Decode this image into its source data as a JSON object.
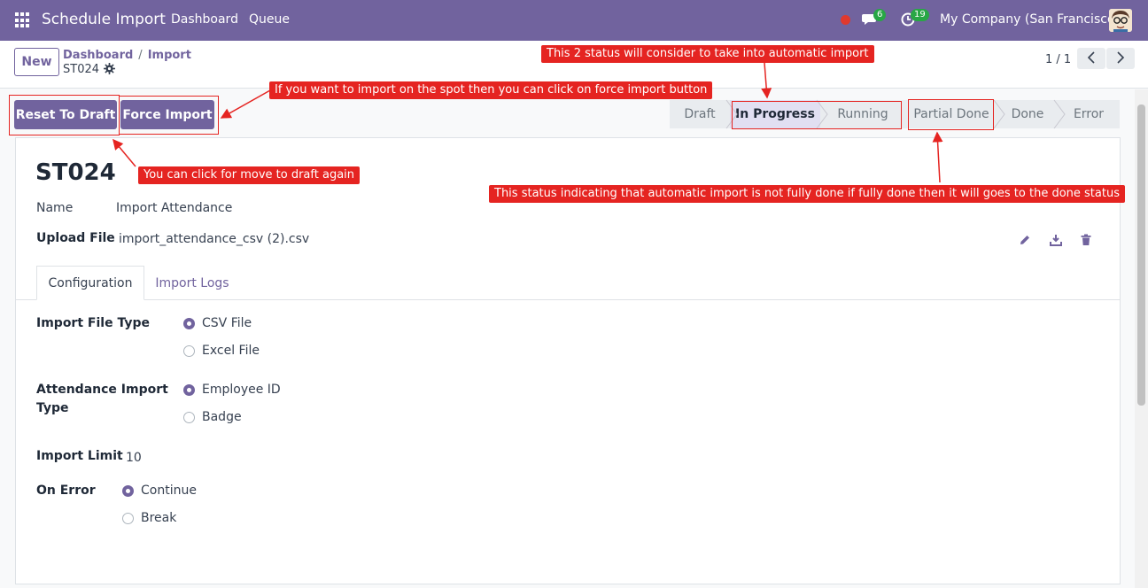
{
  "navbar": {
    "app_title": "Schedule Import",
    "menu": [
      "Dashboard",
      "Queue"
    ],
    "chat_count": "6",
    "activity_count": "19",
    "company": "My Company (San Francisco)"
  },
  "control": {
    "new_label": "New",
    "breadcrumb": [
      "Dashboard",
      "Import"
    ],
    "record": "ST024",
    "pager": "1 / 1"
  },
  "buttons": {
    "reset_draft": "Reset To Draft",
    "force_import": "Force Import"
  },
  "stages": [
    "Draft",
    "In Progress",
    "Running",
    "Partial Done",
    "Done",
    "Error"
  ],
  "active_stage": "In Progress",
  "form": {
    "title": "ST024",
    "name_label": "Name",
    "name_value": "Import Attendance",
    "upload_label": "Upload File",
    "upload_value": "import_attendance_csv (2).csv",
    "tabs": [
      "Configuration",
      "Import Logs"
    ],
    "file_type_label": "Import File Type",
    "file_type_options": [
      "CSV File",
      "Excel File"
    ],
    "att_type_label_1": "Attendance Import",
    "att_type_label_2": "Type",
    "att_type_options": [
      "Employee ID",
      "Badge"
    ],
    "limit_label": "Import Limit",
    "limit_value": "10",
    "on_error_label": "On Error",
    "on_error_options": [
      "Continue",
      "Break"
    ]
  },
  "annotations": {
    "status_note": "This 2 status will consider to take into automatic import",
    "force_note": "If you want to import on the spot then you can click on force import button",
    "draft_note": "You can click for move to draft again",
    "partial_note": "This status indicating that automatic import is not fully done if fully done then it will goes to the done status"
  },
  "colors": {
    "primary": "#71639e",
    "annotation": "#e52421"
  }
}
